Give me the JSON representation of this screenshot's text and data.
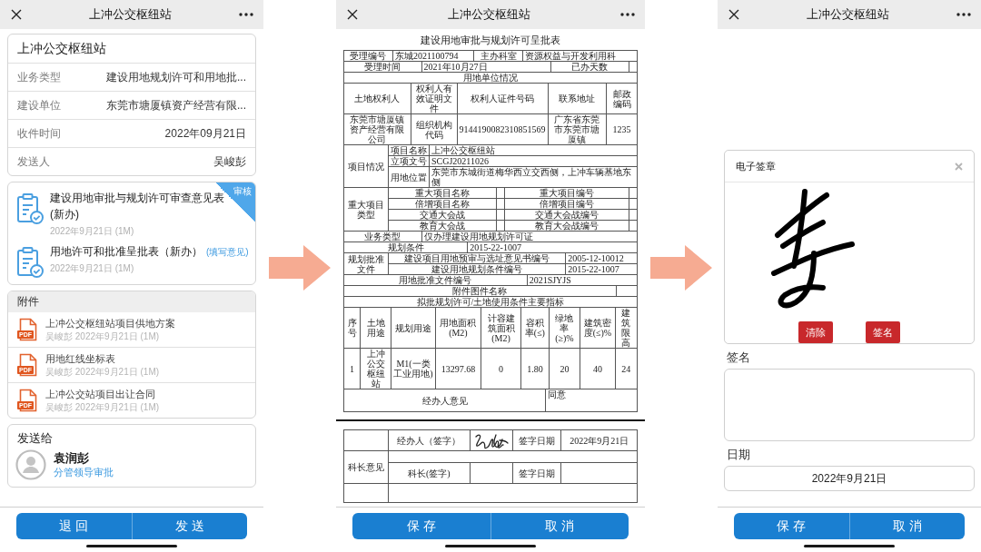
{
  "detail_screen": {
    "header": {
      "title": "上冲公交枢纽站"
    },
    "info_card": {
      "title": "上冲公交枢纽站",
      "rows": [
        {
          "label": "业务类型",
          "value": "建设用地规划许可和用地批..."
        },
        {
          "label": "建设单位",
          "value": "东莞市塘厦镇资产经营有限..."
        },
        {
          "label": "收件时间",
          "value": "2022年09月21日"
        },
        {
          "label": "发送人",
          "value": "吴峻彭"
        }
      ]
    },
    "forms": [
      {
        "title": "建设用地审批与规划许可审查意见表(新办)",
        "meta": "2022年9月21日 (1M)",
        "badge": "审核"
      },
      {
        "title": "用地许可和批准呈批表（新办）",
        "link": "(填写意见)",
        "meta": "2022年9月21日 (1M)"
      }
    ],
    "attachments": {
      "title": "附件",
      "items": [
        {
          "type": "PDF",
          "name": "上冲公交枢纽站项目供地方案",
          "meta": "吴峻彭 2022年9月21日 (1M)"
        },
        {
          "type": "PDF",
          "name": "用地红线坐标表",
          "meta": "吴峻彭 2022年9月21日 (1M)"
        },
        {
          "type": "PDF",
          "name": "上冲公交站项目出让合同",
          "meta": "吴峻彭 2022年9月21日 (1M)"
        }
      ]
    },
    "recipients": {
      "title": "发送给",
      "items": [
        {
          "name": "袁润彭",
          "role": "分管领导审批"
        }
      ]
    },
    "actions": [
      "退 回",
      "发 送"
    ]
  },
  "document_screen": {
    "header": {
      "title": "上冲公交枢纽站"
    },
    "document": {
      "title": "建设用地审批与规划许可呈批表",
      "sections": [
        {
          "kind": "fields",
          "fields": [
            {
              "label": "受理编号",
              "value": "东城2021100794"
            },
            {
              "label": "主办科室",
              "value": "资源权益与开发利用科"
            }
          ]
        },
        {
          "kind": "fields",
          "fields": [
            {
              "label": "受理时间",
              "value": "2021年10月27日"
            },
            {
              "label": "已办天数"
            }
          ]
        },
        {
          "kind": "heading",
          "text": "用地单位情况"
        },
        {
          "kind": "table",
          "columns": [
            "土地权利人",
            "权利人有效证明文件",
            "权利人证件号码",
            "联系地址",
            "邮政编码"
          ],
          "rows": [
            [
              "东莞市塘厦镇资产经营有限公司",
              "组织机构代码",
              "9144190082310851569",
              "广东省东莞市东莞市塘厦镇",
              "1235"
            ]
          ]
        },
        {
          "kind": "group",
          "label": "项目情况",
          "rows": [
            [
              {
                "label": "项目名称",
                "value": "上冲公交枢纽站"
              }
            ],
            [
              {
                "label": "立项文号",
                "value": "SCGJ20211026"
              }
            ],
            [
              {
                "label": "用地位置",
                "value": "东莞市东城街道梅华西立交西侧，上冲车辆基地东侧"
              }
            ]
          ]
        },
        {
          "kind": "group",
          "label": "重大项目类型",
          "rows": [
            [
              {
                "label": "重大项目名称"
              },
              {
                "label": "重大项目编号"
              }
            ],
            [
              {
                "label": "倍增项目名称"
              },
              {
                "label": "倍增项目编号"
              }
            ],
            [
              {
                "label": "交通大会战"
              },
              {
                "label": "交通大会战编号"
              }
            ],
            [
              {
                "label": "教育大会战"
              },
              {
                "label": "教育大会战编号"
              }
            ]
          ]
        },
        {
          "kind": "fields",
          "fields": [
            {
              "label": "业务类型",
              "value": "仅办理建设用地规划许可证"
            }
          ]
        },
        {
          "kind": "fields",
          "fields": [
            {
              "label": "规划条件",
              "value": "2015-22-1007"
            }
          ]
        },
        {
          "kind": "group",
          "label": "规划批准文件",
          "rows": [
            [
              {
                "label": "建设项目用地预审与选址意见书编号",
                "value": "2005-12-10012"
              }
            ],
            [
              {
                "label": "建设用地规划条件编号",
                "value": "2015-22-1007"
              }
            ]
          ]
        },
        {
          "kind": "fields",
          "fields": [
            {
              "label": "用地批准文件编号",
              "value": "2021SJYJS"
            }
          ]
        },
        {
          "kind": "fields",
          "fields": [
            {
              "label": "附件图件名称"
            }
          ]
        },
        {
          "kind": "heading",
          "text": "拟批规划许可/土地使用条件主要指标"
        },
        {
          "kind": "table",
          "columns": [
            "序号",
            "土地用途",
            "规划用途",
            "用地面积(M2)",
            "计容建筑面积(M2)",
            "容积率(≤)",
            "绿地率(≥)%",
            "建筑密度(≤)%",
            "建筑限高"
          ],
          "rows": [
            [
              "1",
              "上冲公交枢纽站",
              "M1(一类工业用地)",
              "13297.68",
              "0",
              "1.80",
              "20",
              "40",
              "24"
            ]
          ]
        },
        {
          "kind": "opinion",
          "label": "经办人意见",
          "value": "同意"
        }
      ],
      "signers": [
        {
          "label": "经办人（签字）",
          "signed": true,
          "date_label": "签字日期",
          "date": "2022年9月21日"
        },
        {
          "group": "科长意见",
          "label": "科长(签字)",
          "signed": false,
          "date_label": "签字日期"
        }
      ]
    },
    "actions": [
      "保 存",
      "取 消"
    ]
  },
  "signature_screen": {
    "header": {
      "title": "上冲公交枢纽站"
    },
    "dialog": {
      "title": "电子签章",
      "buttons": [
        "清除",
        "签名"
      ]
    },
    "fields": [
      {
        "kind": "textarea",
        "label": "签名"
      },
      {
        "kind": "text",
        "label": "日期",
        "value": "2022年9月21日"
      }
    ],
    "actions": [
      "保 存",
      "取 消"
    ]
  }
}
